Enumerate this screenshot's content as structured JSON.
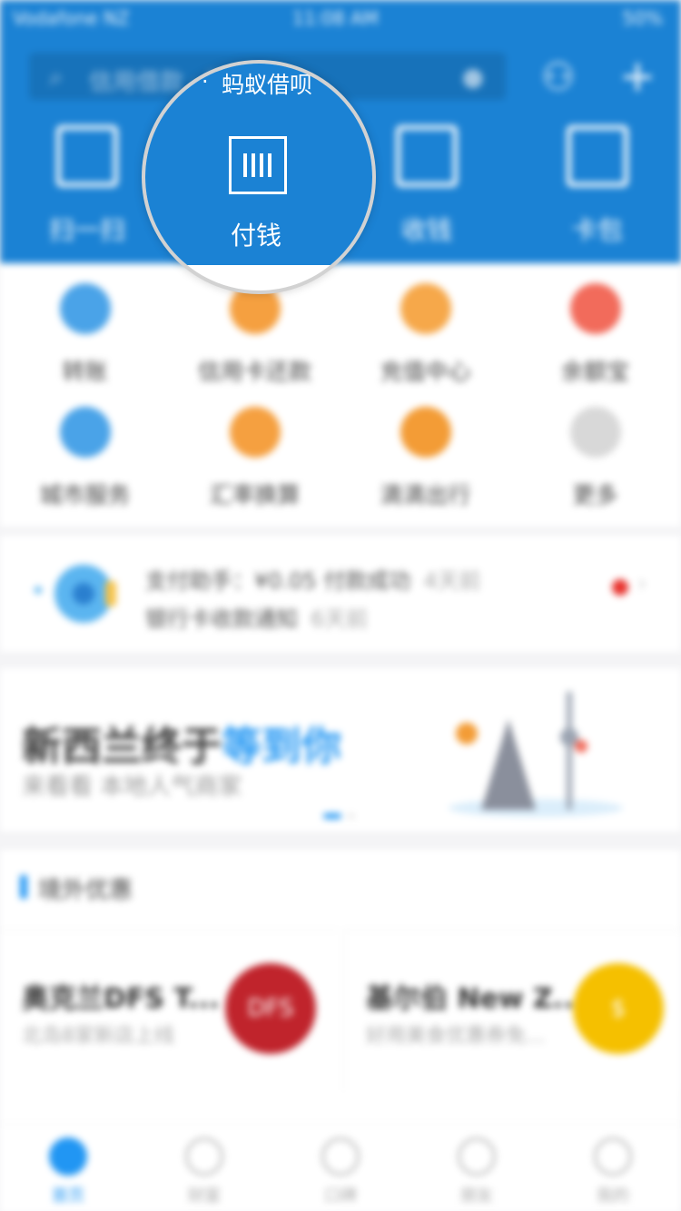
{
  "status_bar": {
    "carrier": "Vodafone NZ",
    "time": "11:08 AM",
    "battery": "50%"
  },
  "search": {
    "placeholder": "信用借款 · 蚂蚁借呗"
  },
  "hero": [
    {
      "label": "扫一扫",
      "icon": "scan-icon"
    },
    {
      "label": "付钱",
      "icon": "pay-icon"
    },
    {
      "label": "收钱",
      "icon": "collect-icon"
    },
    {
      "label": "卡包",
      "icon": "card-icon"
    }
  ],
  "services": [
    {
      "label": "转账",
      "icon": "transfer-icon",
      "color": "#4aa3e8"
    },
    {
      "label": "信用卡还款",
      "icon": "credit-card-icon",
      "color": "#f5a040"
    },
    {
      "label": "充值中心",
      "icon": "topup-icon",
      "color": "#f6a84a"
    },
    {
      "label": "余额宝",
      "icon": "yuebao-icon",
      "color": "#f26b5b"
    },
    {
      "label": "城市服务",
      "icon": "city-icon",
      "color": "#4aa3e8"
    },
    {
      "label": "汇率换算",
      "icon": "exchange-icon",
      "color": "#f5a040"
    },
    {
      "label": "滴滴出行",
      "icon": "didi-icon",
      "color": "#f39c36"
    },
    {
      "label": "更多",
      "icon": "more-icon",
      "color": "#d8d8d8"
    }
  ],
  "notifications": [
    {
      "text": "支付助手：¥0.05 付款成功",
      "time": "4天前"
    },
    {
      "text": "银行卡收款通知",
      "time": "6天前"
    }
  ],
  "banner": {
    "title_main": "新西兰终于",
    "title_highlight": "等到你",
    "subtitle": "来看看 本地人气商家"
  },
  "section": {
    "title": "境外优惠",
    "cards": [
      {
        "title": "奥克兰DFS T...",
        "subtitle": "北岛8家新店上线",
        "logo_text": "DFS",
        "logo_color": "#c0242c"
      },
      {
        "title": "基尔伯 New Z...",
        "subtitle": "好用美食优惠券免...",
        "logo_text": "$",
        "logo_color": "#f5c000"
      }
    ]
  },
  "tabs": [
    {
      "label": "首页",
      "icon": "home-icon",
      "active": true
    },
    {
      "label": "财富",
      "icon": "wealth-icon",
      "active": false
    },
    {
      "label": "口碑",
      "icon": "koubei-icon",
      "active": false
    },
    {
      "label": "朋友",
      "icon": "friends-icon",
      "active": false
    },
    {
      "label": "我的",
      "icon": "profile-icon",
      "active": false
    }
  ],
  "magnifier": {
    "loan_text": "蚂蚁借呗",
    "separator": "·",
    "pay_label": "付钱"
  }
}
